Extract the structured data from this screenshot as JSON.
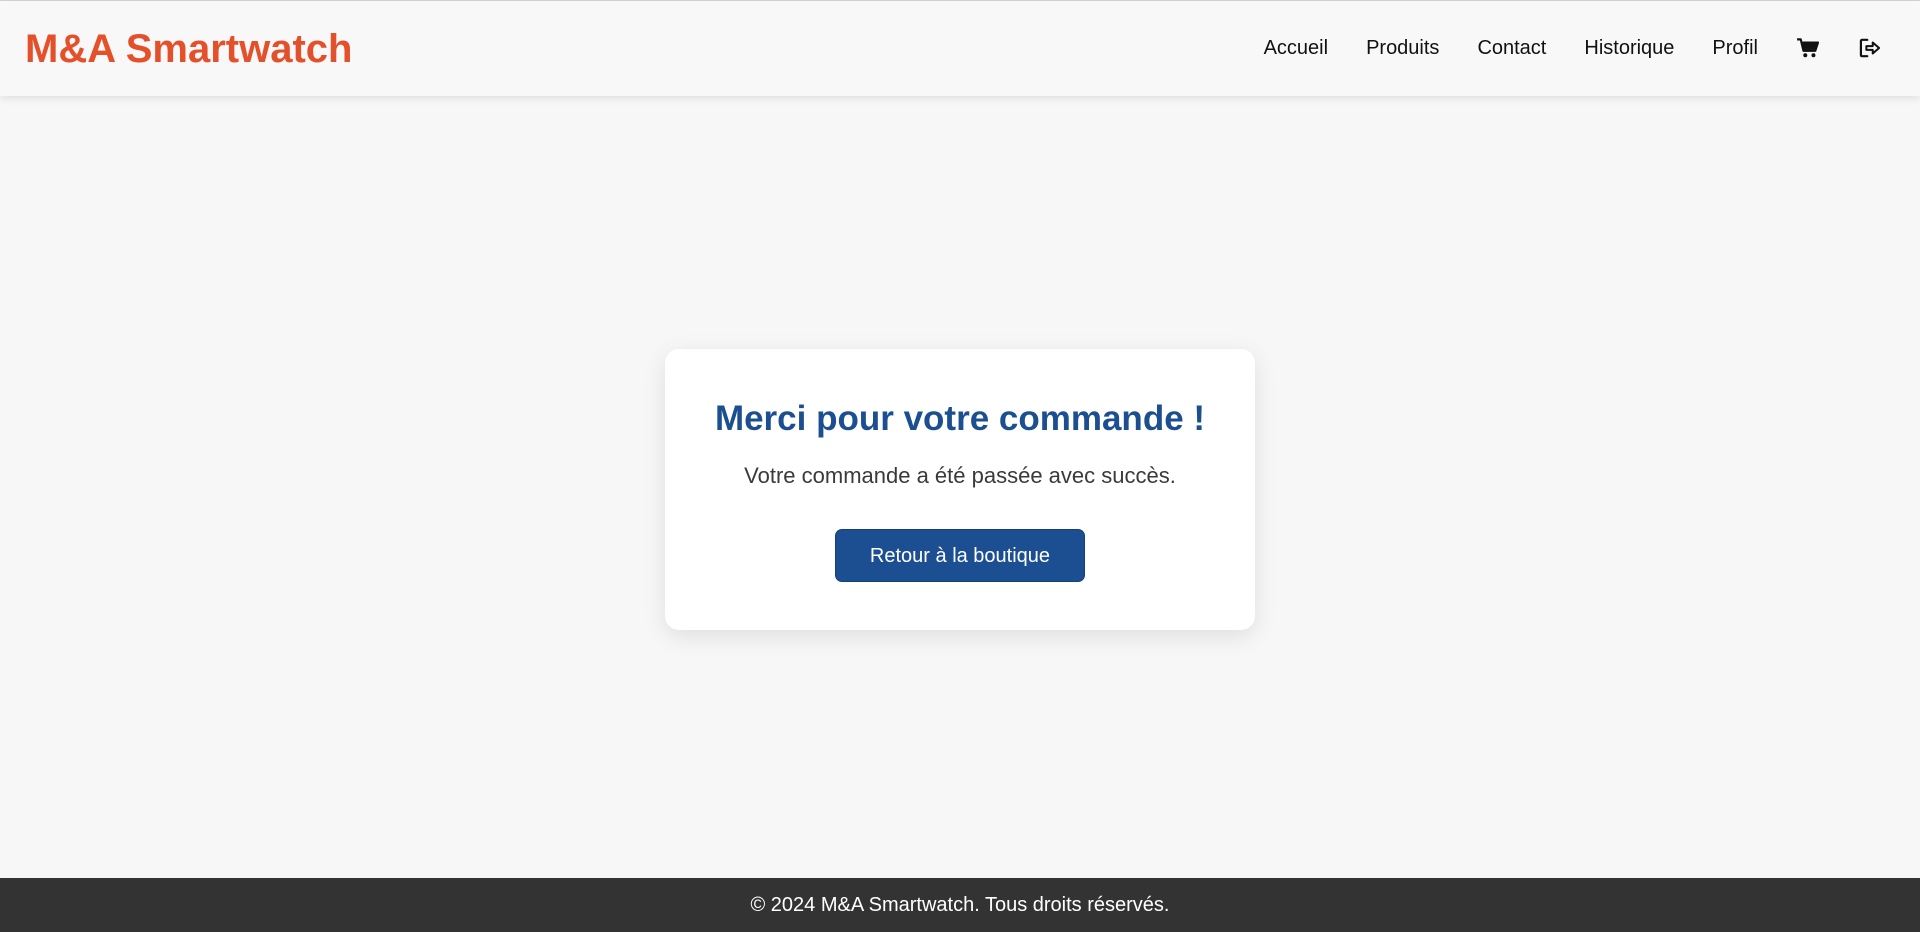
{
  "header": {
    "brand": "M&A Smartwatch",
    "nav": [
      {
        "label": "Accueil"
      },
      {
        "label": "Produits"
      },
      {
        "label": "Contact"
      },
      {
        "label": "Historique"
      },
      {
        "label": "Profil"
      }
    ],
    "icons": {
      "cart": "shopping-cart-icon",
      "logout": "sign-out-icon"
    }
  },
  "confirmation": {
    "title": "Merci pour votre commande !",
    "message": "Votre commande a été passée avec succès.",
    "button_label": "Retour à la boutique"
  },
  "footer": {
    "text": "© 2024 M&A Smartwatch. Tous droits réservés."
  },
  "colors": {
    "brand": "#e4502a",
    "primary": "#1c4f91",
    "background": "#f7f7f7",
    "footer_bg": "#333333"
  }
}
